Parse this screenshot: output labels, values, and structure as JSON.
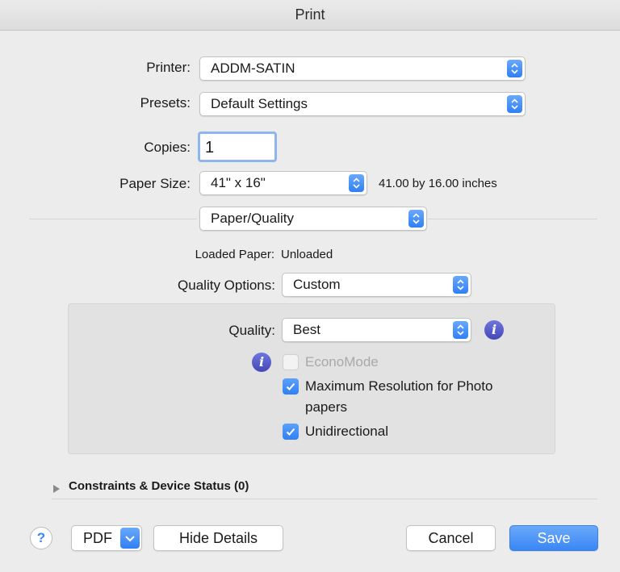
{
  "window": {
    "title": "Print"
  },
  "printer": {
    "label": "Printer:",
    "value": "ADDM-SATIN"
  },
  "presets": {
    "label": "Presets:",
    "value": "Default Settings"
  },
  "copies": {
    "label": "Copies:",
    "value": "1"
  },
  "paper_size": {
    "label": "Paper Size:",
    "value": "41\" x 16\"",
    "dimensions": "41.00 by 16.00 inches"
  },
  "section_popup": {
    "value": "Paper/Quality"
  },
  "loaded_paper": {
    "label": "Loaded Paper:",
    "value": "Unloaded"
  },
  "quality_options": {
    "label": "Quality Options:",
    "value": "Custom"
  },
  "quality": {
    "label": "Quality:",
    "value": "Best"
  },
  "options": {
    "econo_mode": {
      "label": "EconoMode",
      "checked": false,
      "enabled": false
    },
    "max_resolution": {
      "label_line1": "Maximum Resolution for Photo",
      "label_line2": "papers",
      "checked": true
    },
    "unidirectional": {
      "label": "Unidirectional",
      "checked": true
    }
  },
  "constraints": {
    "label": "Constraints & Device Status (0)"
  },
  "footer": {
    "help_label": "?",
    "pdf_label": "PDF",
    "hide_details_label": "Hide Details",
    "cancel_label": "Cancel",
    "save_label": "Save"
  },
  "icons": {
    "info": "info-icon",
    "disclosure": "disclosure-triangle-icon",
    "stepper": "popup-arrows-icon"
  },
  "colors": {
    "accent": "#3a86f5",
    "info": "#4f55c8",
    "background": "#ececec"
  }
}
